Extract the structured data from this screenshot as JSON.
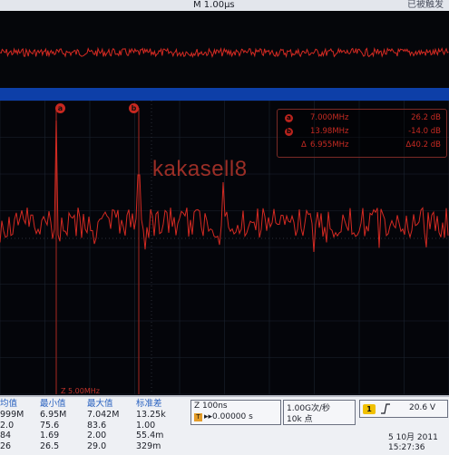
{
  "header": {
    "timebase": "M 1.00µs",
    "trigger_status": "已被触发"
  },
  "watermark": "kakasell8",
  "cursors": [
    {
      "id": "a",
      "frequency": "7.000MHz",
      "amplitude": "26.2 dB"
    },
    {
      "id": "b",
      "frequency": "13.98MHz",
      "amplitude": "-14.0 dB"
    },
    {
      "id": "delta",
      "symbol": "Δ",
      "frequency": "6.955MHz",
      "amplitude": "Δ40.2 dB"
    }
  ],
  "markers": {
    "a": "a",
    "b": "b"
  },
  "center_frequency": "Z 5.00MHz",
  "measurements": {
    "columns": [
      {
        "header": "均值",
        "values": [
          "999M",
          "2.0",
          "84",
          "26"
        ]
      },
      {
        "header": "最小值",
        "values": [
          "6.95M",
          "75.6",
          "1.69",
          "26.5"
        ]
      },
      {
        "header": "最大值",
        "values": [
          "7.042M",
          "83.6",
          "2.00",
          "29.0"
        ]
      },
      {
        "header": "标准差",
        "values": [
          "13.25k",
          "1.00",
          "55.4m",
          "329m"
        ]
      }
    ]
  },
  "zoom": {
    "factor": "Z 100ns",
    "trigger_position_icon": "T",
    "position": "▸▸0.00000 s"
  },
  "acquisition": {
    "sample_rate": "1.00G次/秒",
    "record_length": "10k 点"
  },
  "trigger": {
    "channel": "1",
    "slope_icon": "rising-edge-icon",
    "level": "20.6 V"
  },
  "datetime": {
    "date": "5 10月 2011",
    "time": "15:27:36"
  },
  "colors": {
    "trace": "#d42a22",
    "divider": "#0d3fa8",
    "cursor": "#b8231d"
  }
}
